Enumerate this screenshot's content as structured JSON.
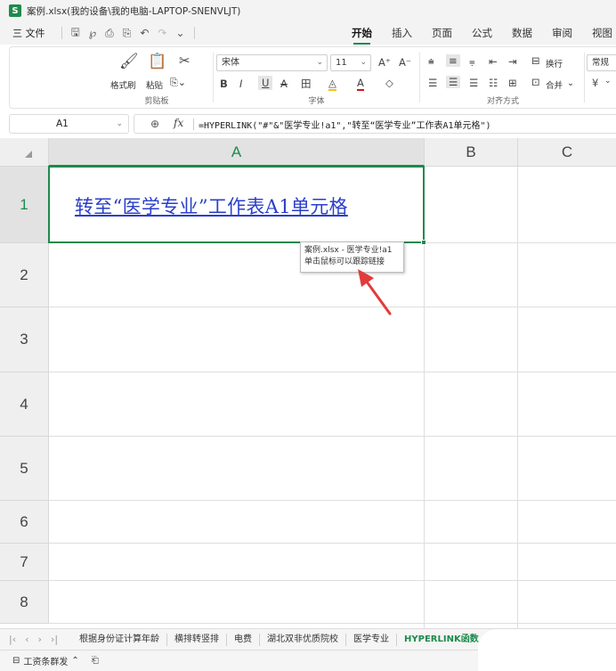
{
  "window": {
    "badge": "S",
    "title": "案例.xlsx(我的设备\\我的电脑-LAPTOP-SNENVLJT)"
  },
  "menu": {
    "file": "三 文件",
    "quick_icons": [
      "save-icon",
      "share-icon",
      "print-icon",
      "preview-icon",
      "undo-icon",
      "redo-icon",
      "more-icon"
    ],
    "tabs": [
      "开始",
      "插入",
      "页面",
      "公式",
      "数据",
      "审阅",
      "视图"
    ],
    "active_tab": "开始"
  },
  "ribbon": {
    "clipboard": {
      "format_painter": "格式刷",
      "paste": "粘贴",
      "group_label": "剪贴板"
    },
    "font": {
      "name": "宋体",
      "size": "11",
      "group_label": "字体",
      "buttons": [
        "B",
        "I",
        "U",
        "A",
        "田",
        "A",
        "A",
        "◇"
      ]
    },
    "align": {
      "wrap": "换行",
      "merge": "合并",
      "group_label": "对齐方式"
    },
    "number": {
      "format": "常规",
      "currency": "¥"
    }
  },
  "formula_bar": {
    "cell_ref": "A1",
    "fx": "fx",
    "formula": "=HYPERLINK(\"#\"&\"医学专业!a1\",\"转至“医学专业”工作表A1单元格\")"
  },
  "grid": {
    "columns": [
      "A",
      "B",
      "C"
    ],
    "rows": [
      "1",
      "2",
      "3",
      "4",
      "5",
      "6",
      "7",
      "8"
    ],
    "a1_text": "转至“医学专业”工作表A1单元格",
    "tooltip_line1": "案例.xlsx - 医学专业!a1",
    "tooltip_line2": "单击鼠标可以跟踪链接"
  },
  "sheets": {
    "tabs": [
      "根据身份证计算年龄",
      "横排转竖排",
      "电费",
      "湖北双非优质院校",
      "医学专业",
      "HYPERLINK函数"
    ],
    "active": "HYPERLINK函数"
  },
  "status": {
    "item1": "工资条群发",
    "item2": "⌃"
  },
  "colors": {
    "accent": "#1e8a4c",
    "link": "#2a3fc9",
    "arrow": "#e23b3b"
  }
}
